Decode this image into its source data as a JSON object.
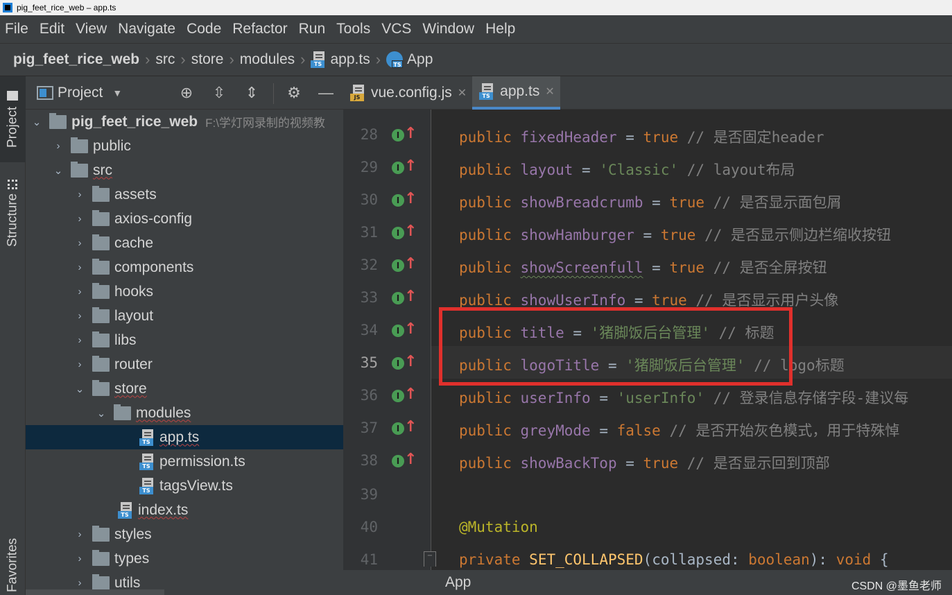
{
  "window": {
    "title": "pig_feet_rice_web – app.ts"
  },
  "menu": [
    "File",
    "Edit",
    "View",
    "Navigate",
    "Code",
    "Refactor",
    "Run",
    "Tools",
    "VCS",
    "Window",
    "Help"
  ],
  "breadcrumb": {
    "project": "pig_feet_rice_web",
    "items": [
      "src",
      "store",
      "modules"
    ],
    "file": "app.ts",
    "symbol": "App"
  },
  "left_strip": {
    "project": "Project",
    "structure": "Structure",
    "favorites": "Favorites"
  },
  "project_panel": {
    "title": "Project",
    "root": {
      "name": "pig_feet_rice_web",
      "path": "F:\\学灯网录制的视频教"
    },
    "items": [
      {
        "label": "public"
      },
      {
        "label": "src"
      },
      {
        "label": "assets"
      },
      {
        "label": "axios-config"
      },
      {
        "label": "cache"
      },
      {
        "label": "components"
      },
      {
        "label": "hooks"
      },
      {
        "label": "layout"
      },
      {
        "label": "libs"
      },
      {
        "label": "router"
      },
      {
        "label": "store"
      },
      {
        "label": "modules"
      },
      {
        "label": "app.ts"
      },
      {
        "label": "permission.ts"
      },
      {
        "label": "tagsView.ts"
      },
      {
        "label": "index.ts"
      },
      {
        "label": "styles"
      },
      {
        "label": "types"
      },
      {
        "label": "utils"
      }
    ]
  },
  "tabs": [
    {
      "label": "vue.config.js",
      "icon": "js-file-icon",
      "active": false
    },
    {
      "label": "app.ts",
      "icon": "ts-file-icon",
      "active": true
    }
  ],
  "editor": {
    "current_line": 35,
    "lines": [
      {
        "n": "28",
        "name": "fixedHeader",
        "value": "true",
        "comment": "// 是否固定header"
      },
      {
        "n": "29",
        "name": "layout",
        "value": "'Classic'",
        "comment": "// layout布局"
      },
      {
        "n": "30",
        "name": "showBreadcrumb",
        "value": "true",
        "comment": "// 是否显示面包屑"
      },
      {
        "n": "31",
        "name": "showHamburger",
        "value": "true",
        "comment": "// 是否显示侧边栏缩收按钮"
      },
      {
        "n": "32",
        "name": "showScreenfull",
        "value": "true",
        "comment": "// 是否全屏按钮"
      },
      {
        "n": "33",
        "name": "showUserInfo",
        "value": "true",
        "comment": "// 是否显示用户头像"
      },
      {
        "n": "34",
        "name": "title",
        "value": "'猪脚饭后台管理'",
        "comment": "// 标题"
      },
      {
        "n": "35",
        "name": "logoTitle",
        "value": "'猪脚饭后台管理'",
        "comment": "// logo标题"
      },
      {
        "n": "36",
        "name": "userInfo",
        "value": "'userInfo'",
        "comment": "// 登录信息存储字段-建议每"
      },
      {
        "n": "37",
        "name": "greyMode",
        "value": "false",
        "comment": "// 是否开始灰色模式，用于特殊悼"
      },
      {
        "n": "38",
        "name": "showBackTop",
        "value": "true",
        "comment": "// 是否显示回到顶部"
      }
    ],
    "keyword_public": "public",
    "eq": " = ",
    "line39": "39",
    "line40": "40",
    "annotation": "@Mutation",
    "line41": "41",
    "l41_private": "private",
    "l41_fn": "SET_COLLAPSED",
    "l41_param": "(collapsed: ",
    "l41_type": "boolean",
    "l41_ret": "): ",
    "l41_void": "void",
    "l41_brace": " {"
  },
  "status": {
    "crumb": "App",
    "watermark": "CSDN @墨鱼老师"
  },
  "colors": {
    "highlight_box": "#e0302c",
    "accent": "#4a88c7"
  }
}
